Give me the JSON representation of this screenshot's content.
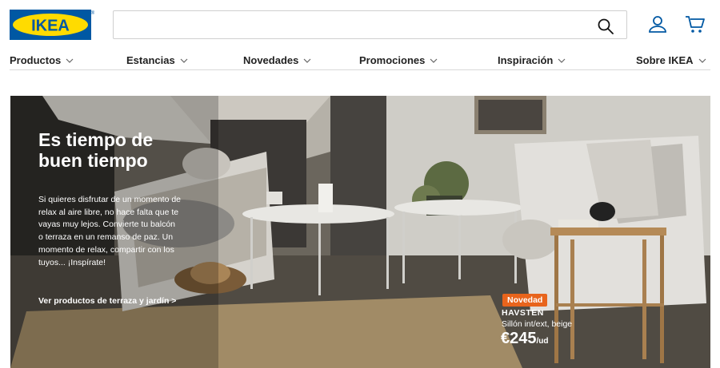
{
  "brand": {
    "logo_text": "IKEA",
    "registered_mark": "®",
    "logo_blue": "#0058a3",
    "logo_yellow": "#ffdb00"
  },
  "header": {
    "search_placeholder": "",
    "icons": [
      "search-icon",
      "user-icon",
      "cart-icon"
    ]
  },
  "nav": {
    "items": [
      {
        "label": "Productos"
      },
      {
        "label": "Estancias"
      },
      {
        "label": "Novedades"
      },
      {
        "label": "Promociones"
      },
      {
        "label": "Inspiración"
      },
      {
        "label": "Sobre IKEA"
      }
    ]
  },
  "hero": {
    "title_line1": "Es tiempo de",
    "title_line2": "buen tiempo",
    "body": "Si quieres disfrutar de un momento de relax al aire libre, no hace falta que te vayas muy lejos. Convierte tu balcón o terraza en un remanso de paz. Un momento de relax, compartir con los tuyos... ¡Inspírate!",
    "cta": "Ver productos de terraza y jardín >"
  },
  "product": {
    "badge": "Novedad",
    "name": "HAVSTEN",
    "description": "Sillón int/ext, beige",
    "price": "€245",
    "unit": "/ud",
    "badge_color": "#e8641c"
  }
}
